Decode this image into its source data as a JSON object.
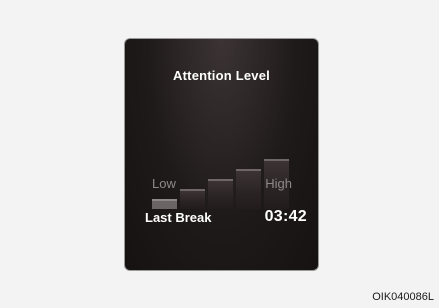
{
  "display": {
    "title": "Attention Level",
    "attention_level": {
      "total_bars": 5,
      "active_bars": 1
    },
    "scale": {
      "low_label": "Low",
      "high_label": "High"
    },
    "last_break": {
      "label": "Last Break",
      "time": "03:42"
    }
  },
  "image_code": "OIK040086L"
}
